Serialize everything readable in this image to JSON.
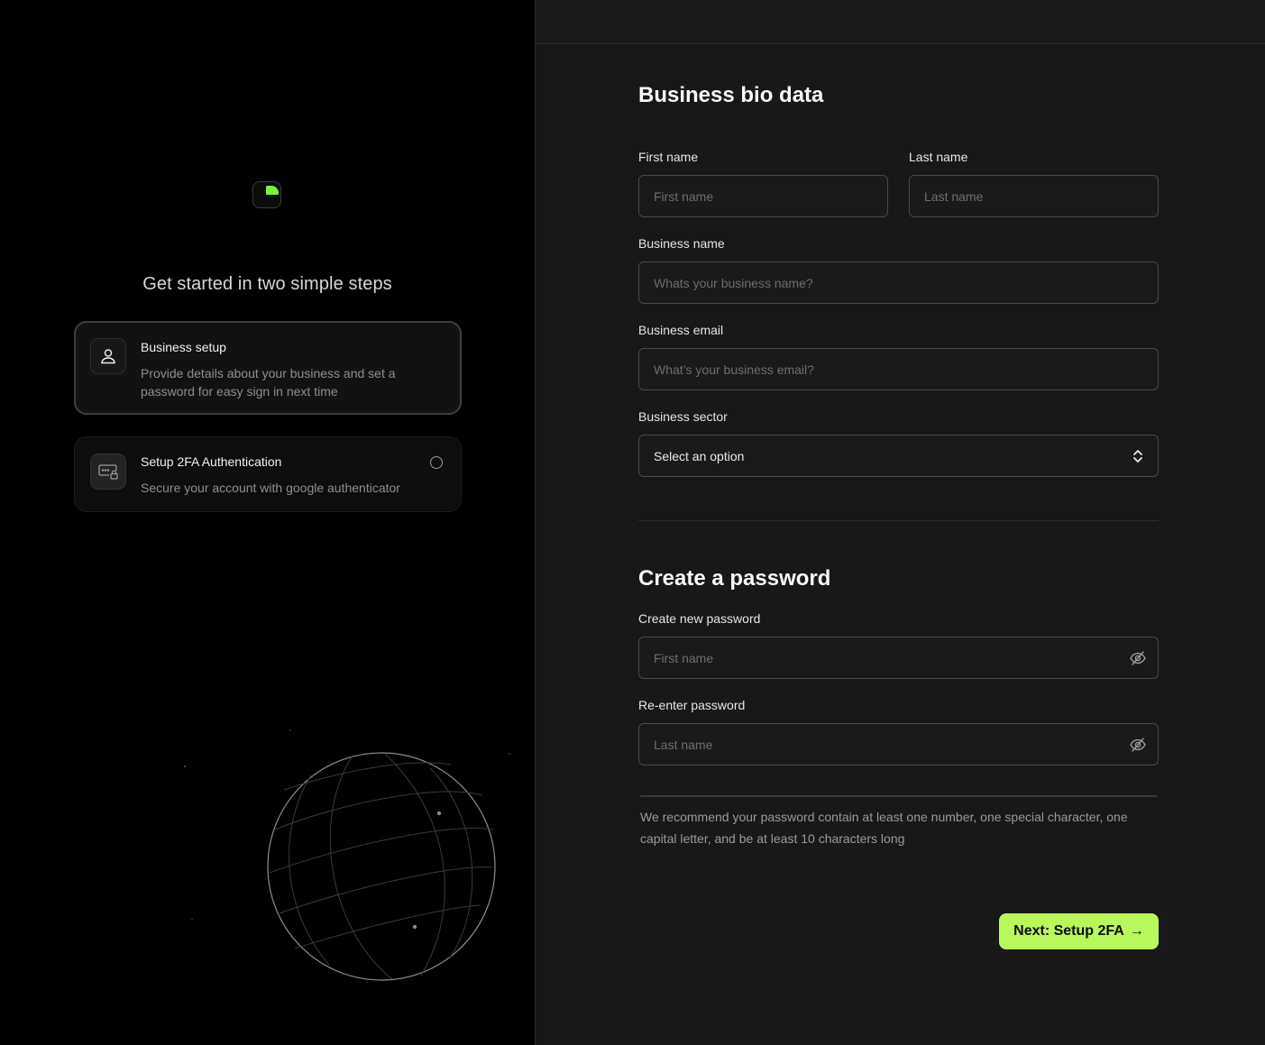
{
  "left": {
    "title": "Get started in two simple steps",
    "steps": [
      {
        "title": "Business setup",
        "description": "Provide details about your business and set a password for easy sign in next time",
        "icon": "user-icon",
        "state": "active"
      },
      {
        "title": "Setup 2FA Authentication",
        "description": "Secure your account with google authenticator",
        "icon": "password-lock-icon",
        "state": "pending"
      }
    ]
  },
  "form": {
    "bio_title": "Business bio data",
    "first_name": {
      "label": "First name",
      "placeholder": "First name"
    },
    "last_name": {
      "label": "Last name",
      "placeholder": "Last name"
    },
    "business_name": {
      "label": "Business name",
      "placeholder": "Whats your business name?"
    },
    "business_email": {
      "label": "Business email",
      "placeholder": "What’s your business email?"
    },
    "business_sector": {
      "label": "Business sector",
      "value": "Select an option"
    },
    "password_title": "Create a password",
    "new_password": {
      "label": "Create new password",
      "placeholder": "First name"
    },
    "reenter_password": {
      "label": "Re-enter password",
      "placeholder": "Last name"
    },
    "hint": "We recommend your password contain at least one number, one special character, one capital letter, and be at least 10 characters long",
    "next_label": "Next: Setup 2FA",
    "next_arrow": "→"
  },
  "colors": {
    "accent": "#b8f85a",
    "logo_green": "#7ff23a",
    "panel_bg": "#181818",
    "left_bg": "#000000"
  }
}
